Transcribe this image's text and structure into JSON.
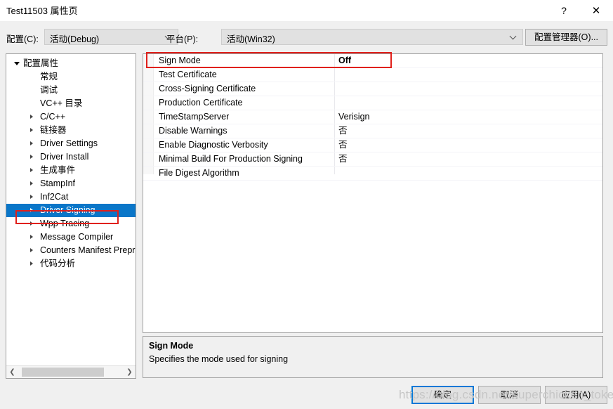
{
  "window": {
    "title": "Test11503 属性页",
    "help_icon": "question-mark-icon",
    "help_label": "?",
    "close_icon": "close-icon",
    "close_label": "✕"
  },
  "configbar": {
    "config_label": "配置(C):",
    "config_value": "活动(Debug)",
    "platform_label": "平台(P):",
    "platform_value": "活动(Win32)",
    "config_manager_label": "配置管理器(O)..."
  },
  "tree": {
    "items": [
      {
        "label": "配置属性",
        "depth": 0,
        "expander": "down",
        "selected": false
      },
      {
        "label": "常规",
        "depth": 1,
        "expander": "none",
        "selected": false
      },
      {
        "label": "调试",
        "depth": 1,
        "expander": "none",
        "selected": false
      },
      {
        "label": "VC++ 目录",
        "depth": 1,
        "expander": "none",
        "selected": false
      },
      {
        "label": "C/C++",
        "depth": 1,
        "expander": "right",
        "selected": false
      },
      {
        "label": "链接器",
        "depth": 1,
        "expander": "right",
        "selected": false
      },
      {
        "label": "Driver Settings",
        "depth": 1,
        "expander": "right",
        "selected": false
      },
      {
        "label": "Driver Install",
        "depth": 1,
        "expander": "right",
        "selected": false
      },
      {
        "label": "生成事件",
        "depth": 1,
        "expander": "right",
        "selected": false
      },
      {
        "label": "StampInf",
        "depth": 1,
        "expander": "right",
        "selected": false
      },
      {
        "label": "Inf2Cat",
        "depth": 1,
        "expander": "right",
        "selected": false
      },
      {
        "label": "Driver Signing",
        "depth": 1,
        "expander": "right",
        "selected": true
      },
      {
        "label": "Wpp Tracing",
        "depth": 1,
        "expander": "right",
        "selected": false
      },
      {
        "label": "Message Compiler",
        "depth": 1,
        "expander": "right",
        "selected": false
      },
      {
        "label": "Counters Manifest Prepr",
        "depth": 1,
        "expander": "right",
        "selected": false
      },
      {
        "label": "代码分析",
        "depth": 1,
        "expander": "right",
        "selected": false
      }
    ],
    "scrollbar": {
      "left_arrow": "❮",
      "right_arrow": "❯"
    }
  },
  "grid": {
    "rows": [
      {
        "name": "Sign Mode",
        "value": "Off",
        "bold": true
      },
      {
        "name": "Test Certificate",
        "value": "",
        "bold": false
      },
      {
        "name": "Cross-Signing Certificate",
        "value": "",
        "bold": false
      },
      {
        "name": "Production Certificate",
        "value": "",
        "bold": false
      },
      {
        "name": "TimeStampServer",
        "value": "Verisign",
        "bold": false
      },
      {
        "name": "Disable Warnings",
        "value": "否",
        "bold": false
      },
      {
        "name": "Enable Diagnostic Verbosity",
        "value": "否",
        "bold": false
      },
      {
        "name": "Minimal Build For Production Signing",
        "value": "否",
        "bold": false
      },
      {
        "name": "File Digest Algorithm",
        "value": "",
        "bold": false
      }
    ]
  },
  "description": {
    "title": "Sign Mode",
    "body": "Specifies the mode used for signing"
  },
  "footer": {
    "ok_label": "确定",
    "cancel_label": "取消",
    "apply_label": "应用(A)"
  },
  "watermark": {
    "text": "https://blog.csdn.net/superchicken_token"
  },
  "colors": {
    "selection_blue": "#0a76c8",
    "highlight_red": "#e0201b",
    "focus_blue": "#0078d7",
    "dialog_bg": "#f0f0f0"
  }
}
